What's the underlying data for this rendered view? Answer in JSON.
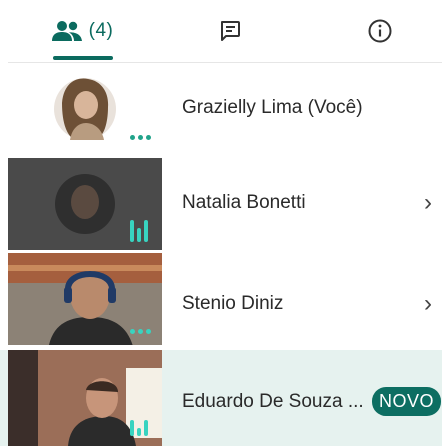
{
  "tabs": {
    "people": {
      "count": "(4)",
      "icon": "people-icon"
    },
    "chat": {
      "icon": "chat-icon"
    },
    "info": {
      "icon": "info-icon"
    }
  },
  "participants": [
    {
      "name": "Grazielly Lima (Você)",
      "indicator": "more-dots"
    },
    {
      "name": "Natalia Bonetti",
      "indicator": "audio-bars",
      "chevron": "›"
    },
    {
      "name": "Stenio Diniz",
      "indicator": "more-dots",
      "chevron": "›"
    },
    {
      "name": "Eduardo De Souza ...",
      "indicator": "audio-bars",
      "badge": "NOVO"
    }
  ],
  "colors": {
    "accent": "#0b6b5f",
    "indicator": "#21a38a",
    "highlight_row": "#e6f2ef"
  }
}
